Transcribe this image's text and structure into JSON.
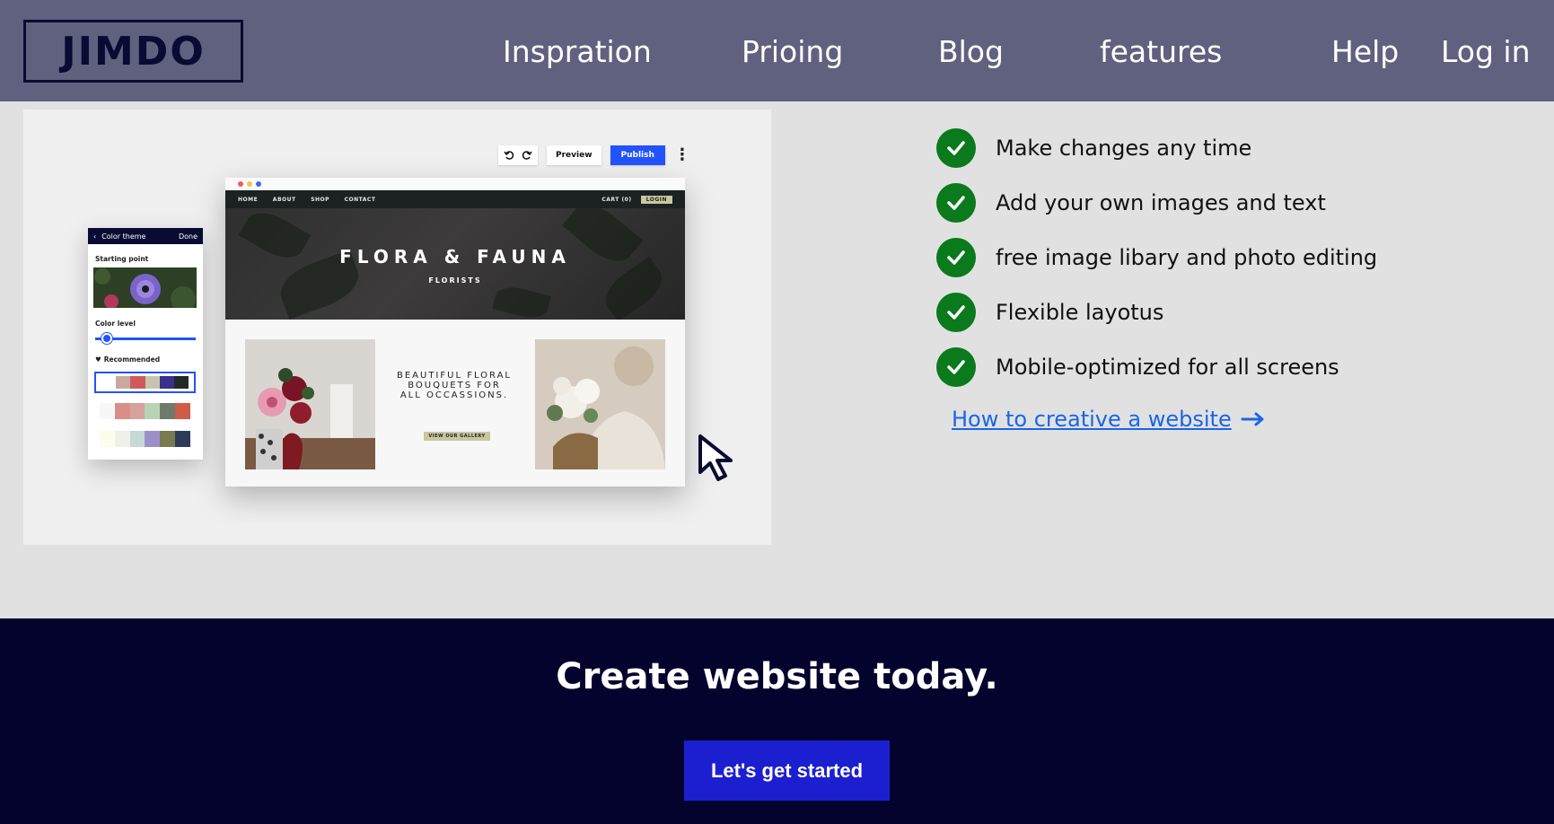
{
  "nav": {
    "logo": "JIMDO",
    "links": [
      "Inspration",
      "Prioing",
      "Blog",
      "features",
      "Help",
      "Log in"
    ]
  },
  "mockup": {
    "toolbar": {
      "preview": "Preview",
      "publish": "Publish"
    },
    "site": {
      "nav_items": [
        "HOME",
        "ABOUT",
        "SHOP",
        "CONTACT"
      ],
      "cart": "CART (0)",
      "login": "LOGIN",
      "title": "FLORA & FAUNA",
      "subtitle": "FLORISTS",
      "tagline": "BEAUTIFUL FLORAL BOUQUETS FOR ALL OCCASSIONS.",
      "gallery_button": "VIEW OUR GALLERY"
    },
    "phone": {
      "header": "Color theme",
      "done": "Done",
      "starting_point": "Starting point",
      "color_level": "Color level",
      "recommended": "Recommended"
    },
    "palettes": [
      [
        "#ffffff",
        "#c9a99f",
        "#d05a5a",
        "#c9c3b0",
        "#3a2f8a",
        "#1f2a24"
      ],
      [
        "#f7f7f7",
        "#d98f87",
        "#d5a39b",
        "#b8d3b5",
        "#6f7a6a",
        "#cf5b49"
      ],
      [
        "#fdfdee",
        "#eef0e9",
        "#c7d8d5",
        "#9c8fc9",
        "#787a4f",
        "#2f3a58"
      ]
    ]
  },
  "features": {
    "items": [
      "Make changes any time",
      "Add your own images and text",
      "free image libary and photo editing",
      "Flexible layotus",
      "Mobile-optimized for all screens"
    ],
    "link": "How to creative a website"
  },
  "cta": {
    "title": "Create website today.",
    "button": "Let's get started"
  },
  "colors": {
    "nav_bg": "#5f617f",
    "page_bg": "#e1e1e1",
    "cta_bg": "#03032e",
    "cta_button": "#1c1fd0",
    "check_green": "#0a7a1c",
    "link_blue": "#1a66e6"
  },
  "icons": [
    "check-icon",
    "arrow-right-icon",
    "undo-icon",
    "redo-icon",
    "more-vertical-icon",
    "cursor-icon",
    "chevron-left-icon",
    "heart-icon"
  ]
}
